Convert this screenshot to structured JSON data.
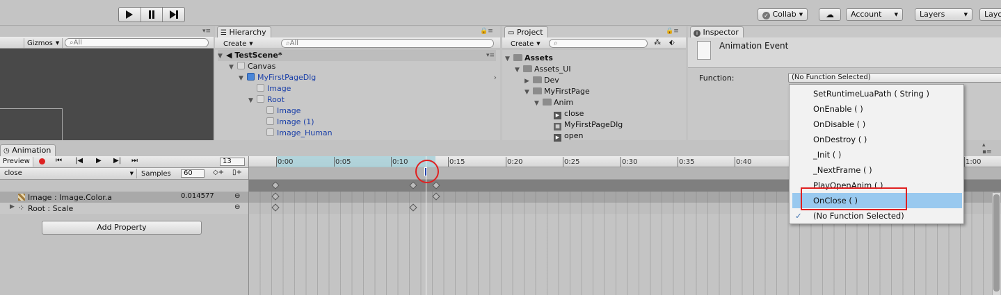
{
  "toolbar": {
    "collab": "Collab",
    "account": "Account",
    "layers": "Layers",
    "layout": "Layo"
  },
  "scene_panel": {
    "gizmos": "Gizmos",
    "search_placeholder": "All"
  },
  "hierarchy": {
    "tab": "Hierarchy",
    "create": "Create",
    "search_placeholder": "All",
    "scene_name": "TestScene*",
    "items": [
      {
        "label": "Canvas"
      },
      {
        "label": "MyFirstPageDlg"
      },
      {
        "label": "Image"
      },
      {
        "label": "Root"
      },
      {
        "label": "Image"
      },
      {
        "label": "Image (1)"
      },
      {
        "label": "Image_Human"
      }
    ]
  },
  "project": {
    "tab": "Project",
    "create": "Create",
    "items": [
      {
        "label": "Assets"
      },
      {
        "label": "Assets_UI"
      },
      {
        "label": "Dev"
      },
      {
        "label": "MyFirstPage"
      },
      {
        "label": "Anim"
      },
      {
        "label": "close"
      },
      {
        "label": "MyFirstPageDlg"
      },
      {
        "label": "open"
      }
    ]
  },
  "inspector": {
    "tab": "Inspector",
    "object_name": "Animation Event",
    "function_label": "Function:",
    "function_value": "(No Function Selected)"
  },
  "dropdown": {
    "items": [
      {
        "label": "SetRuntimeLuaPath ( String )"
      },
      {
        "label": "OnEnable ( )"
      },
      {
        "label": "OnDisable ( )"
      },
      {
        "label": "OnDestroy ( )"
      },
      {
        "label": "_Init ( )"
      },
      {
        "label": "_NextFrame ( )"
      },
      {
        "label": "PlayOpenAnim ( )"
      },
      {
        "label": "OnClose ( )"
      },
      {
        "label": "(No Function Selected)"
      }
    ],
    "highlighted": "OnClose ( )",
    "checked": "(No Function Selected)"
  },
  "animation": {
    "tab": "Animation",
    "preview": "Preview",
    "frame": "13",
    "clip": "close",
    "samples_label": "Samples",
    "samples_value": "60",
    "properties": [
      {
        "label": "Image : Image.Color.a",
        "value": "0.014577"
      },
      {
        "label": "Root : Scale",
        "value": ""
      }
    ],
    "add_property": "Add Property",
    "timeline_ticks": [
      "0:00",
      "0:05",
      "0:10",
      "0:15",
      "0:20",
      "0:25",
      "0:30",
      "0:35",
      "0:40",
      "1:00"
    ]
  },
  "colors": {
    "accent_blue": "#99c9ef",
    "highlight_red": "#e02020",
    "timeline_cyan": "#a8d0d8"
  }
}
